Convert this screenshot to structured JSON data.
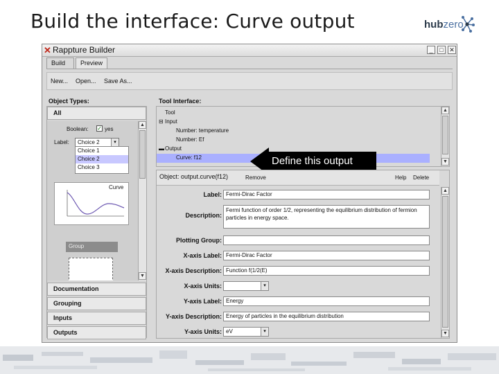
{
  "slide": {
    "title": "Build the interface:  Curve output"
  },
  "logo": {
    "prefix": "hub",
    "suffix": "zero",
    "icon": "hub-network-icon"
  },
  "window": {
    "title": "Rappture Builder",
    "close_glyph": "✕",
    "min_glyph": "_",
    "max_glyph": "□",
    "winclose_glyph": "✕"
  },
  "tabs": [
    "Build",
    "Preview"
  ],
  "toolbar": {
    "new": "New...",
    "open": "Open...",
    "save_as": "Save As..."
  },
  "left": {
    "heading": "Object Types:",
    "all_label": "All",
    "boolean_label": "Boolean:",
    "boolean_value": "yes",
    "choice_label": "Label:",
    "choice_value": "Choice 2",
    "choice_options": [
      "Choice 1",
      "Choice 2",
      "Choice 3"
    ],
    "curve_label": "Curve",
    "group_label": "Group",
    "sections": [
      "Documentation",
      "Grouping",
      "Inputs",
      "Outputs"
    ]
  },
  "tree": {
    "heading": "Tool Interface:",
    "rows": [
      {
        "label": "Tool",
        "indent": 0
      },
      {
        "label": "Input",
        "indent": 0
      },
      {
        "label": "Number: temperature",
        "indent": 1
      },
      {
        "label": "Number: Ef",
        "indent": 1
      },
      {
        "label": "Output",
        "indent": 0
      },
      {
        "label": "Curve: f12",
        "indent": 1
      }
    ]
  },
  "callout": {
    "text": "Define this output"
  },
  "object": {
    "title": "Object: output.curve(f12)",
    "remove": "Remove",
    "help": "Help",
    "delete": "Delete",
    "fields": {
      "label": {
        "name": "Label:",
        "value": "Fermi-Dirac Factor"
      },
      "description": {
        "name": "Description:",
        "value": "Fermi function of order 1/2, representing the equilibrium distribution of fermion particles in energy space."
      },
      "plotting_group": {
        "name": "Plotting Group:",
        "value": ""
      },
      "x_label": {
        "name": "X-axis Label:",
        "value": "Fermi-Dirac Factor"
      },
      "x_desc": {
        "name": "X-axis Description:",
        "value": "Function f(1/2(E)"
      },
      "x_units": {
        "name": "X-axis Units:",
        "value": ""
      },
      "y_label": {
        "name": "Y-axis Label:",
        "value": "Energy"
      },
      "y_desc": {
        "name": "Y-axis Description:",
        "value": "Energy of particles in the equilibrium distribution"
      },
      "y_units": {
        "name": "Y-axis Units:",
        "value": "eV"
      }
    }
  },
  "colors": {
    "tree_selection": "#aab0ff",
    "close_x": "#c0271a"
  }
}
